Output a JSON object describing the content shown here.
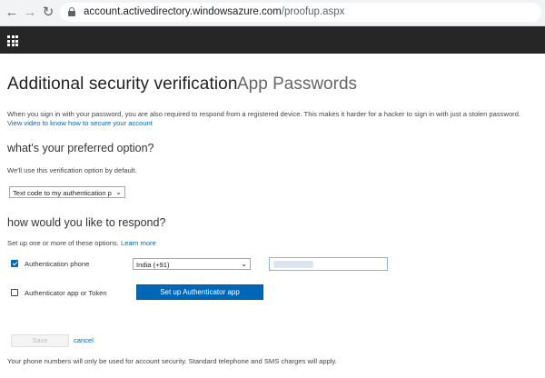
{
  "browser": {
    "url_host": "account.activedirectory.windowsazure.com",
    "url_path": "/proofup.aspx"
  },
  "page": {
    "title": "Additional security verification",
    "tab": "App Passwords",
    "intro_text": "When you sign in with your password, you are also required to respond from a registered device. This makes it harder for a hacker to sign in with just a stolen password.",
    "intro_link": "View video to know how to secure your account"
  },
  "preferred": {
    "heading": "what's your preferred option?",
    "subtext": "We'll use this verification option by default.",
    "selected_option": "Text code to my authentication p"
  },
  "respond": {
    "heading": "how would you like to respond?",
    "subtext": "Set up one or more of these options.",
    "learn_more": "Learn more",
    "auth_phone_label": "Authentication phone",
    "auth_phone_checked": true,
    "country_value": "India (+91)",
    "auth_app_label": "Authenticator app or Token",
    "auth_app_checked": false,
    "setup_button": "Set up Authenticator app"
  },
  "actions": {
    "save": "Save",
    "cancel": "cancel"
  },
  "footer": {
    "text": "Your phone numbers will only be used for account security. Standard telephone and SMS charges will apply."
  },
  "colors": {
    "accent": "#0067b8",
    "header_bg": "#262626"
  },
  "icons": {
    "back": "arrow-left",
    "forward": "arrow-right",
    "reload": "reload",
    "lock": "lock",
    "waffle": "app-launcher-grid"
  }
}
